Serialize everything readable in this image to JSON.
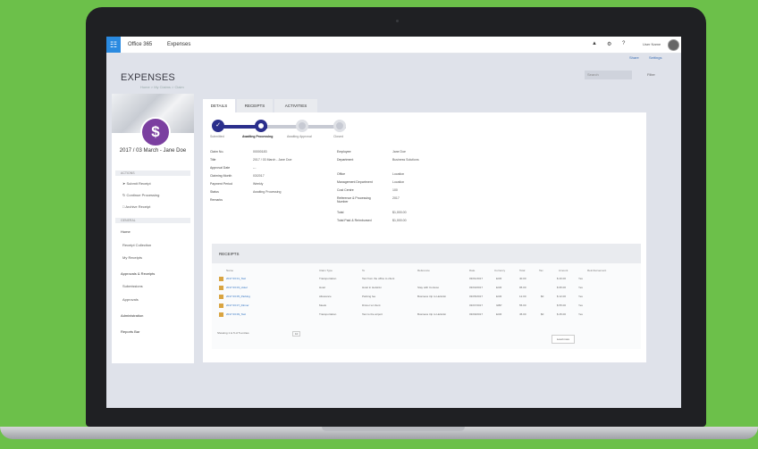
{
  "app": {
    "title": "Office 365",
    "module": "Expenses",
    "user_name": "User Name"
  },
  "subbar": {
    "links": [
      "Share",
      "Settings"
    ]
  },
  "page": {
    "title": "EXPENSES",
    "breadcrumb": "Home > My Claims > Claim",
    "search_placeholder": "Search",
    "filter_label": "Filter"
  },
  "claim": {
    "name": "2017 / 03 March - Jane Doe",
    "icon": "dollar-icon",
    "accent": "#7b3fa0"
  },
  "left_panel": {
    "actions_header": "ACTIONS",
    "actions": [
      "Submit Receipt",
      "Continue Processing",
      "Archive Receipt"
    ],
    "nav_header": "GENERAL",
    "nav": [
      {
        "label": "Home",
        "bold": true
      },
      {
        "label": "Receipt Collection",
        "bold": false
      },
      {
        "label": "My Receipts",
        "bold": false
      },
      {
        "label": "Approvals & Receipts",
        "bold": true
      },
      {
        "label": "Submissions",
        "bold": false
      },
      {
        "label": "Approvals",
        "bold": false
      },
      {
        "label": "Administration",
        "bold": true
      },
      {
        "label": "Reports Bar",
        "bold": true
      }
    ]
  },
  "tabs": [
    "DETAILS",
    "RECEIPTS",
    "ACTIVITIES"
  ],
  "steps": [
    {
      "label": "Submitted",
      "state": "done"
    },
    {
      "label": "Awaiting Processing",
      "state": "current"
    },
    {
      "label": "Awaiting Approval",
      "state": "future"
    },
    {
      "label": "Closed",
      "state": "future"
    }
  ],
  "details_left": [
    {
      "label": "Claim No.",
      "value": "00000183"
    },
    {
      "label": "Title",
      "value": "2017 / 03 March - Jane Doe"
    },
    {
      "label": "Approval Date",
      "value": "---"
    },
    {
      "label": "Claiming Month",
      "value": "03/2017"
    },
    {
      "label": "Payment Period",
      "value": "Weekly"
    },
    {
      "label": "Status",
      "value": "Awaiting Processing"
    },
    {
      "label": "Remarks",
      "value": ""
    }
  ],
  "details_right": [
    {
      "label": "Employee",
      "value": "Jane Doe"
    },
    {
      "label": "Department",
      "value": "Business Solutions"
    },
    {
      "label": "Office",
      "value": "Location"
    },
    {
      "label": "Management Department",
      "value": "Location"
    },
    {
      "label": "Cost Centre",
      "value": "100"
    },
    {
      "label": "Reference & Processing Number",
      "value": "2017"
    },
    {
      "label": "Total",
      "value": "$1,000.00"
    },
    {
      "label": "Total Paid & Reimbursed",
      "value": "$1,000.00"
    }
  ],
  "receipts": {
    "title": "RECEIPTS",
    "columns": [
      "Name",
      "Claim Type",
      "To",
      "Reference",
      "Date",
      "Currency",
      "Total",
      "Tax",
      "Amount",
      "Reimbursement"
    ],
    "rows": [
      [
        "2017 03 01_Taxi",
        "Transportation",
        "Taxi from the office to client",
        "",
        "03/01/2017",
        "EUR",
        "40.00",
        "",
        "$ 40.00",
        "Yes"
      ],
      [
        "2017 03 03_Hotel",
        "Hotel",
        "Hotel in Helsinki",
        "Stay with Contoso",
        "03/03/2017",
        "EUR",
        "95.00",
        "",
        "$ 95.00",
        "Yes"
      ],
      [
        "2017 03 05_Parking",
        "Allowance",
        "Parking fee",
        "Business trip to Helsinki",
        "03/05/2017",
        "EUR",
        "12.00",
        "$0",
        "$ 12.00",
        "Yes"
      ],
      [
        "2017 03 07_Dinner",
        "Meals",
        "Dinner w/ client",
        "",
        "03/07/2017",
        "GBP",
        "55.00",
        "",
        "$ 55.00",
        "Yes"
      ],
      [
        "2017 03 09_Taxi",
        "Transportation",
        "Taxi to the airport",
        "Business trip to Helsinki",
        "03/09/2017",
        "EUR",
        "45.00",
        "$0",
        "$ 45.00",
        "Yes"
      ]
    ],
    "pagination": "Showing 1 to 5 of 5 entries",
    "page_size": "10",
    "load_more": "Load more"
  }
}
